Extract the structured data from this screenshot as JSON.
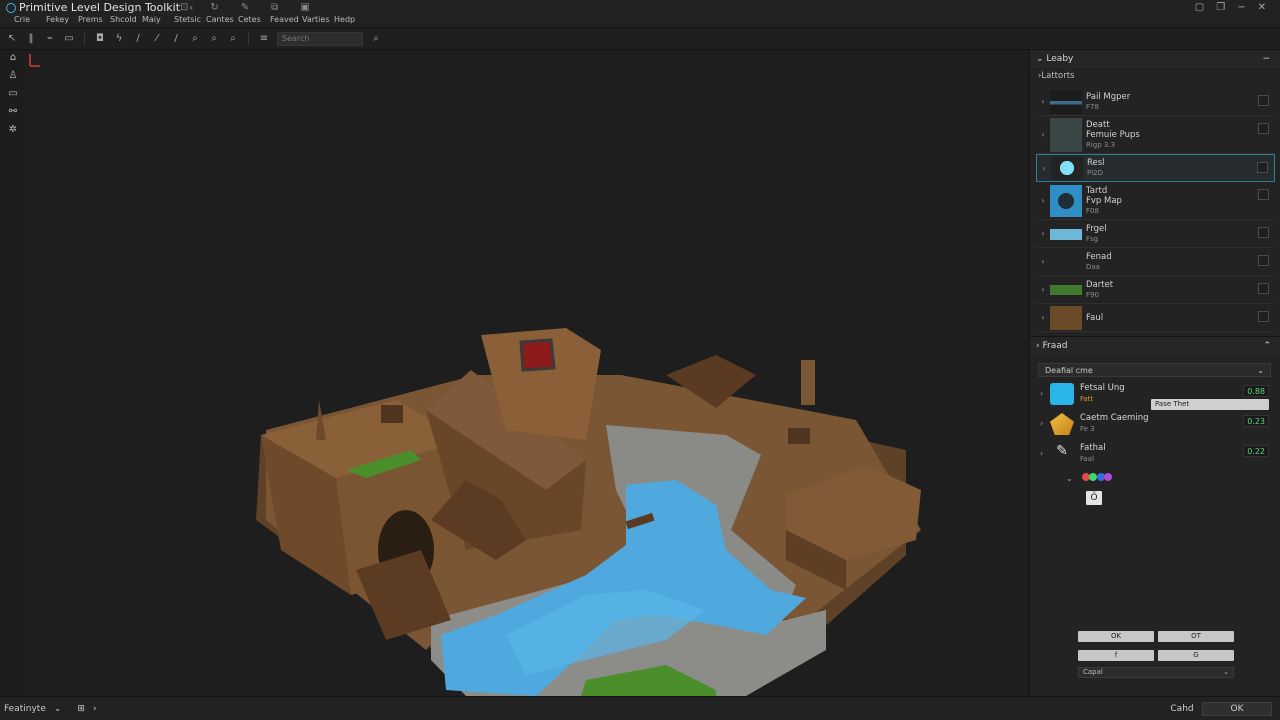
{
  "app": {
    "title": "Primitive Level Design Toolkit",
    "menus": [
      "Crie",
      "Fekey",
      "Prems",
      "Shcold",
      "Maiy",
      "Stetsic",
      "Cantes",
      "Cetes",
      "Feaved",
      "Varties",
      "Hedp"
    ]
  },
  "toolbar": {
    "search_placeholder": "Search"
  },
  "panel": {
    "library_title": "Leaby",
    "library_sub": "Lattorts",
    "assets": [
      {
        "name": "Pail Mgper",
        "sub": "F78",
        "thumb": "#3a6d8a"
      },
      {
        "name": "Deatt",
        "name2": "Femuie Pups",
        "sub": "Rigp 3.3",
        "thumb": "#3b4646"
      },
      {
        "name": "Resl",
        "sub": "Pl2D",
        "thumb": "#5fc7e6"
      },
      {
        "name": "Tartd",
        "name2": "Fvp Map",
        "sub": "F08",
        "thumb": "#2f8fc4"
      },
      {
        "name": "Frgel",
        "sub": "Fsg",
        "thumb": "#6fb7d6"
      },
      {
        "name": "Fenad",
        "sub": "Daa",
        "thumb": "#3a3a3a"
      },
      {
        "name": "Dartet",
        "sub": "F90",
        "thumb": "#3f7a2e"
      },
      {
        "name": "Faul",
        "sub": "",
        "thumb": "#6b4a2a"
      }
    ],
    "props_title": "Fraad",
    "preset_label": "Deafial cme",
    "props": [
      {
        "name": "Fetsal Ung",
        "sub": "Fatt",
        "value": "0.88",
        "select": "Pase Thet",
        "icon": "#29b5e8"
      },
      {
        "name": "Caetm Caeming",
        "sub": "Fe 3",
        "value": "0.23",
        "icon": "#e0a830"
      },
      {
        "name": "Fathal",
        "sub": "Faal",
        "value": "0.22",
        "icon": "#d9d9d9"
      }
    ],
    "extra_icon": "Ö",
    "buttons": [
      "OK",
      "OT",
      "f",
      "G"
    ],
    "bottom_select": "Capal"
  },
  "status": {
    "left_label": "Featinyte",
    "cancel": "Cahd",
    "ok": "OK"
  },
  "colors": {
    "accent": "#2f7c99",
    "water": "#4fa9de",
    "ground": "#7a5634",
    "grass": "#4b8f2c"
  }
}
